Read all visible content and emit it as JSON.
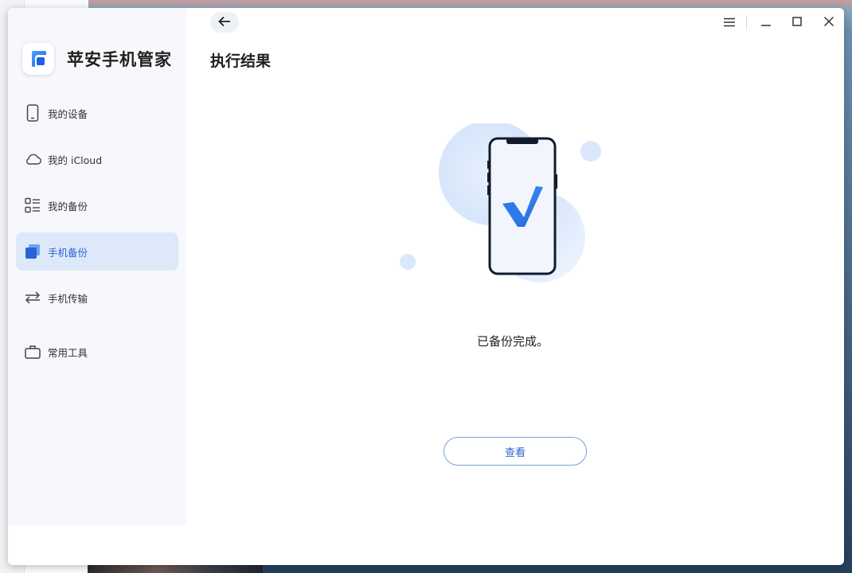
{
  "app": {
    "name": "苹安手机管家"
  },
  "sidebar": {
    "items": [
      {
        "label": "我的设备",
        "icon": "phone-icon",
        "active": false
      },
      {
        "label": "我的 iCloud",
        "icon": "cloud-icon",
        "active": false
      },
      {
        "label": "我的备份",
        "icon": "list-icon",
        "active": false
      },
      {
        "label": "手机备份",
        "icon": "backup-icon",
        "active": true
      },
      {
        "label": "手机传输",
        "icon": "transfer-icon",
        "active": false
      },
      {
        "label": "常用工具",
        "icon": "toolbox-icon",
        "active": false
      }
    ]
  },
  "header": {
    "title": "执行结果",
    "back_icon": "arrow-left-icon"
  },
  "window_controls": {
    "menu_icon": "menu-icon",
    "minimize_icon": "minimize-icon",
    "maximize_icon": "maximize-icon",
    "close_icon": "close-icon"
  },
  "result": {
    "message": "已备份完成。",
    "illustration_icon": "phone-check-icon",
    "view_button_label": "查看"
  },
  "colors": {
    "accent": "#2a63d6",
    "active_nav_bg": "#dde8f8",
    "sidebar_bg": "#f6f8fb",
    "button_border": "#7aa0de"
  }
}
